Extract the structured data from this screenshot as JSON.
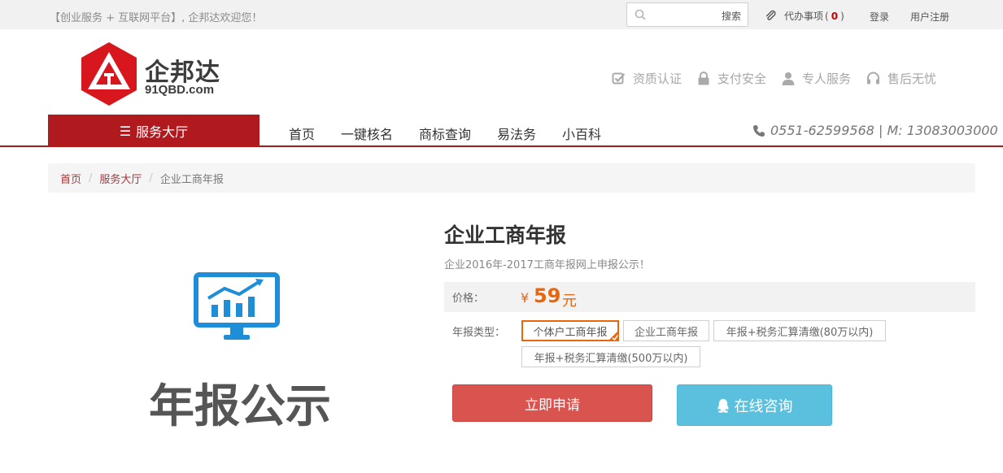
{
  "topbar": {
    "welcome": "【创业服务 + 互联网平台】, 企邦达欢迎您！",
    "search_placeholder": "",
    "search_button": "搜索",
    "todo_label": "代办事项",
    "todo_open": "(",
    "todo_count": "0",
    "todo_close": ")",
    "login": "登录",
    "register": "用户注册"
  },
  "header": {
    "logo_brand": "企邦达",
    "logo_domain": "91QBD.com",
    "badges": [
      "资质认证",
      "支付安全",
      "专人服务",
      "售后无忧"
    ]
  },
  "nav": {
    "hall_icon": "☰",
    "hall_label": "服务大厅",
    "items": [
      "首页",
      "一键核名",
      "商标查询",
      "易法务",
      "小百科"
    ],
    "phone": "0551-62599568 | M: 13083003000"
  },
  "breadcrumb": {
    "items": [
      "首页",
      "服务大厅"
    ],
    "separator": "/",
    "current": "企业工商年报"
  },
  "product": {
    "image_text": "年报公示",
    "title": "企业工商年报",
    "subtitle": "企业2016年-2017工商年报网上申报公示！",
    "price_label": "价格：",
    "price_symbol": "¥",
    "price_value": "59",
    "price_unit": "元",
    "type_label": "年报类型：",
    "type_options": [
      "个体户工商年报",
      "企业工商年报",
      "年报+税务汇算清缴(80万以内)",
      "年报+税务汇算清缴(500万以内)"
    ],
    "selected_option": "个体户工商年报",
    "apply_button": "立即申请",
    "consult_button": "在线咨询"
  },
  "colors": {
    "brand_red": "#b0191e",
    "price_orange": "#e8660d",
    "apply_red": "#d9534f",
    "consult_blue": "#5bc0de",
    "icon_blue": "#1e8ed8"
  }
}
